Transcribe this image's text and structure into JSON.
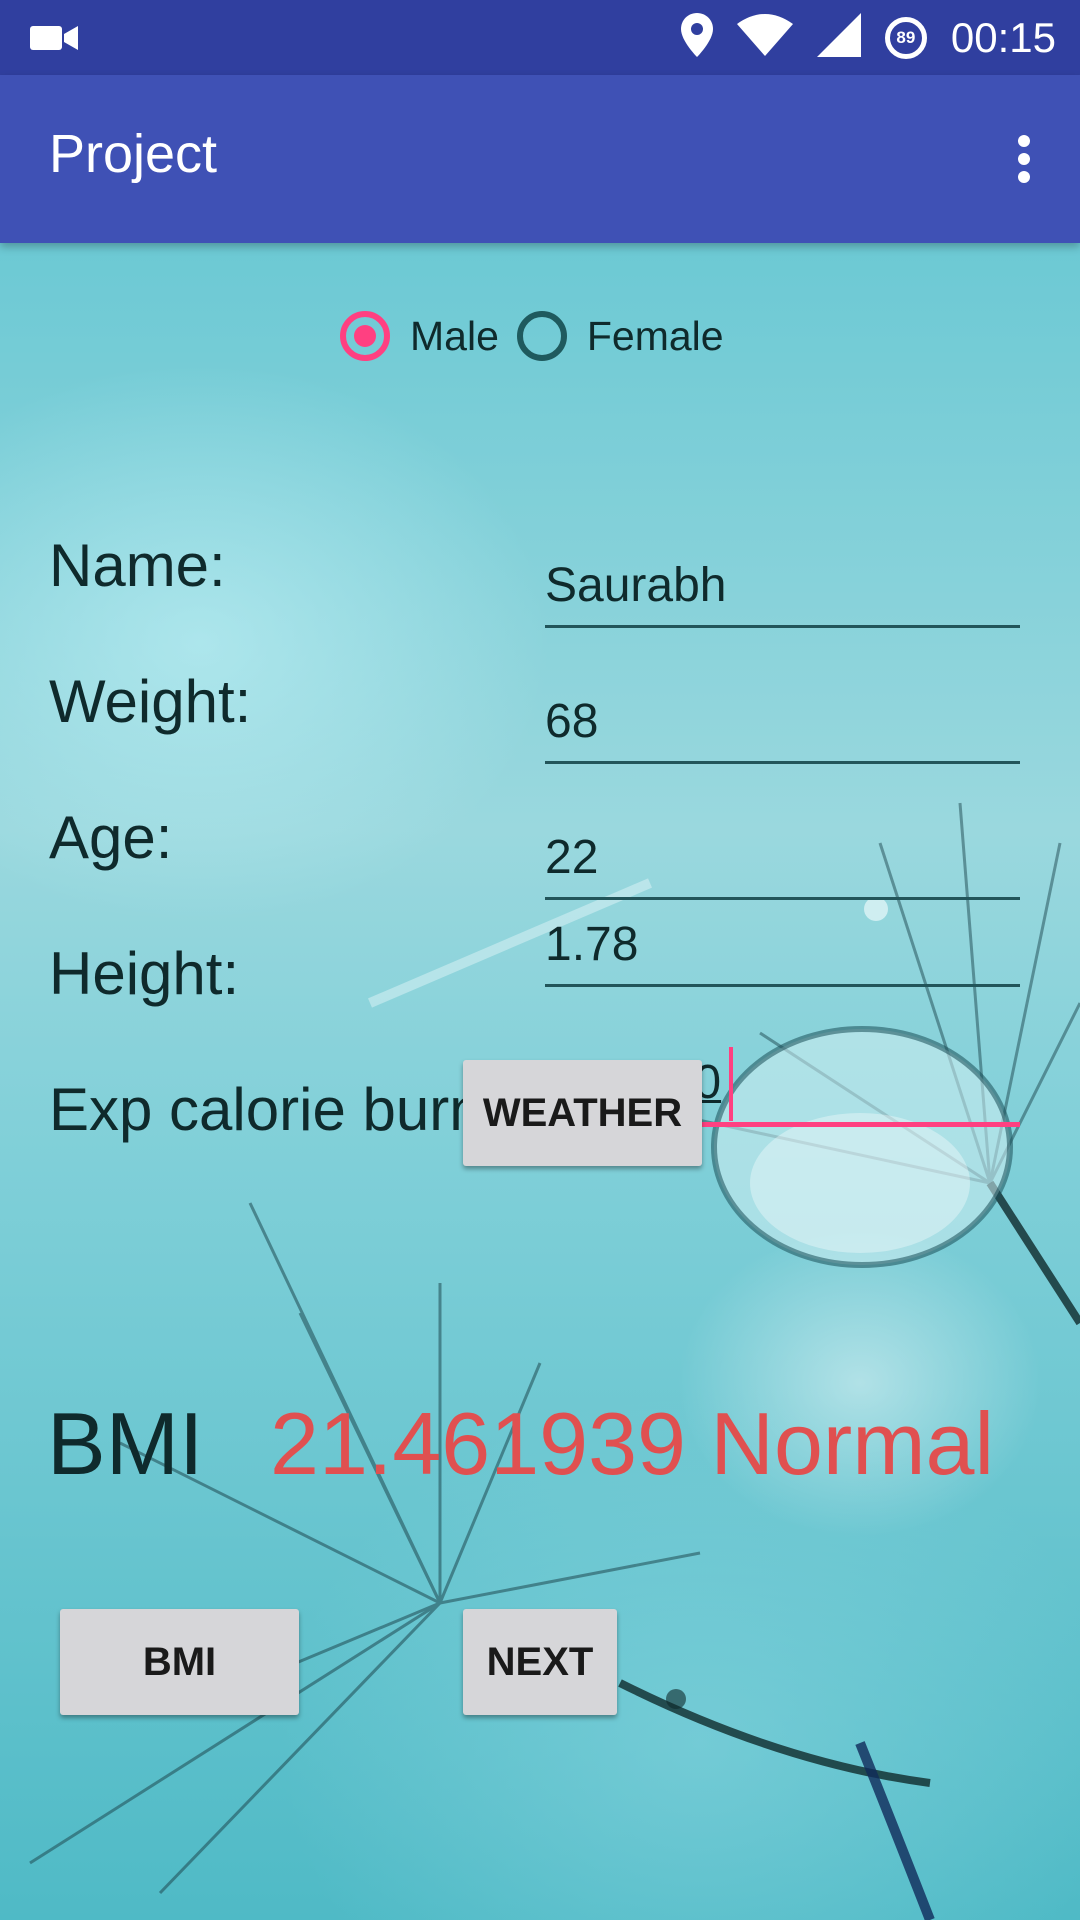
{
  "status_bar": {
    "time": "00:15",
    "battery_level": "89",
    "icons": [
      "video-camera-icon",
      "location-pin-icon",
      "wifi-icon",
      "cell-signal-icon",
      "battery-ring-icon"
    ]
  },
  "app_bar": {
    "title": "Project",
    "menu_icon": "more-vert-icon"
  },
  "gender": {
    "options": [
      {
        "label": "Male",
        "checked": true
      },
      {
        "label": "Female",
        "checked": false
      }
    ]
  },
  "form": {
    "name_label": "Name:",
    "name_value": "Saurabh",
    "weight_label": "Weight:",
    "weight_value": "68",
    "age_label": "Age:",
    "age_value": "22",
    "height_label": "Height:",
    "height_value": "1.78",
    "calorie_label": "Exp calorie burn:",
    "calorie_value": "650"
  },
  "buttons": {
    "weather": "WEATHER",
    "bmi": "BMI",
    "next": "NEXT"
  },
  "result": {
    "label": "BMI",
    "value": "21.461939 Normal"
  },
  "colors": {
    "status_bar": "#303f9f",
    "app_bar": "#3f51b5",
    "accent": "#ff4081",
    "result_text": "#e05050"
  }
}
